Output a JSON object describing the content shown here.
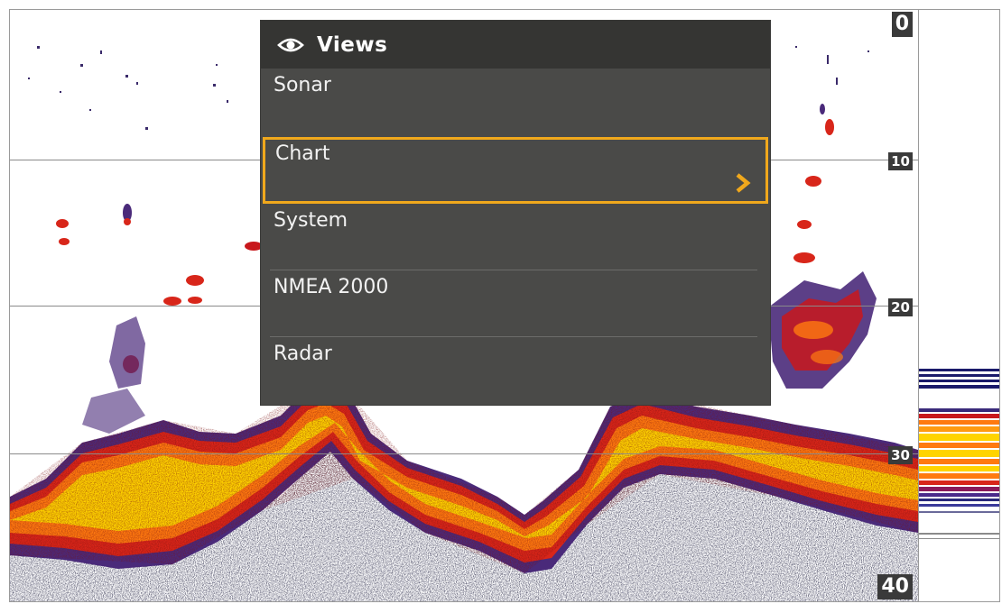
{
  "depth_scale": {
    "labels": [
      "0",
      "10",
      "20",
      "30",
      "40"
    ]
  },
  "views_menu": {
    "icon": "eye-icon",
    "title": "Views",
    "items": [
      {
        "label": "Sonar",
        "selected": false,
        "has_submenu": false
      },
      {
        "label": "Chart",
        "selected": true,
        "has_submenu": true
      },
      {
        "label": "System",
        "selected": false,
        "has_submenu": false
      },
      {
        "label": "NMEA 2000",
        "selected": false,
        "has_submenu": false
      },
      {
        "label": "Radar",
        "selected": false,
        "has_submenu": false
      }
    ],
    "submenu_icon": "chevron-right-icon"
  },
  "colors": {
    "menu_bg": "#4a4a48",
    "menu_header_bg": "#353533",
    "selection_border": "#f0a81c",
    "sonar_strong": "#ffd400",
    "sonar_medium": "#ff7a00",
    "sonar_weak": "#c8181c",
    "sonar_faint": "#3a2a6a"
  }
}
